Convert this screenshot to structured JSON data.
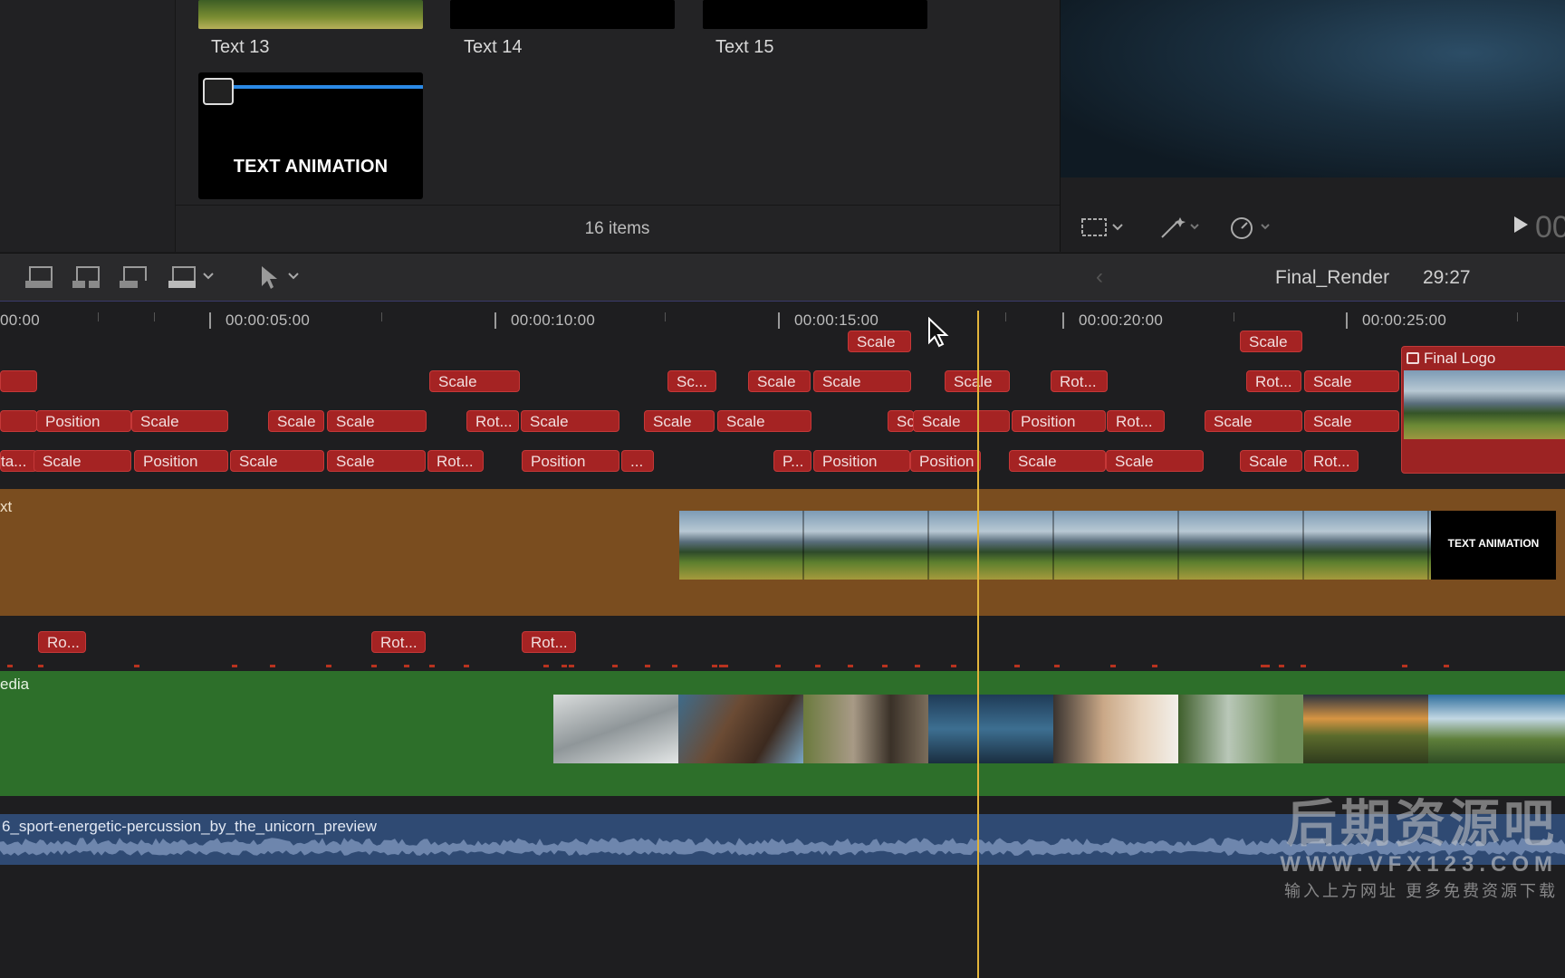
{
  "browser": {
    "clips": [
      {
        "label": "Text 13"
      },
      {
        "label": "Text 14"
      },
      {
        "label": "Text 15"
      }
    ],
    "selected_clip_title": "TEXT ANIMATION",
    "items_count": "16 items"
  },
  "viewer": {
    "timecode_partial": "00"
  },
  "toolbar": {
    "project_name": "Final_Render",
    "project_duration": "29:27"
  },
  "ruler": {
    "labels": [
      "00:00",
      "00:00:05:00",
      "00:00:10:00",
      "00:00:15:00",
      "00:00:20:00",
      "00:00:25:00"
    ]
  },
  "keyframe_rows": {
    "row0": [
      "Scale",
      "Scale"
    ],
    "row1": [
      "",
      "Scale",
      "Sc...",
      "Scale",
      "Scale",
      "Scale",
      "Rot...",
      "Rot...",
      "Scale"
    ],
    "row2": [
      "",
      "Position",
      "Scale",
      "Scale",
      "Scale",
      "Rot...",
      "Scale",
      "Scale",
      "Scale",
      "Sc",
      "Scale",
      "Position",
      "Rot...",
      "Scale",
      "Scale"
    ],
    "row3": [
      "ta...",
      "Scale",
      "Position",
      "Scale",
      "Scale",
      "Rot...",
      "Position",
      "...",
      "P...",
      "Position",
      "Position",
      "Scale",
      "Scale",
      "Scale",
      "Rot..."
    ],
    "lower_row": [
      "Ro...",
      "Rot...",
      "Rot..."
    ]
  },
  "tracks": {
    "main_label": "xt",
    "main_end_title": "TEXT ANIMATION",
    "final_logo_label": "Final Logo",
    "media_label": "edia",
    "audio_label": "6_sport-energetic-percussion_by_the_unicorn_preview"
  },
  "watermark": {
    "cn": "后期资源吧",
    "url": "WWW.VFX123.COM",
    "sub": "输入上方网址 更多免费资源下载"
  }
}
